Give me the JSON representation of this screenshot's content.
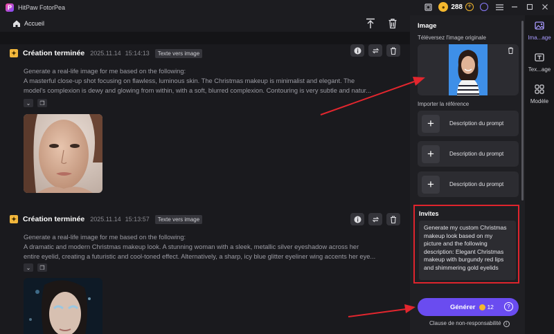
{
  "app": {
    "title": "HitPaw FotorPea",
    "credits": "288"
  },
  "nav": {
    "home_label": "Accueil"
  },
  "cards": [
    {
      "status": "Création terminée",
      "date": "2025.11.14",
      "time": "15:14:13",
      "tag": "Texte vers image",
      "prompt_line1": "Generate a real-life image for me based on the following:",
      "prompt_line2": "A masterful close-up shot focusing on flawless, luminous skin. The Christmas makeup is minimalist and elegant. The",
      "prompt_line3": "model's complexion is dewy and glowing from within, with a soft, blurred complexion. Contouring is very subtle and natur..."
    },
    {
      "status": "Création terminée",
      "date": "2025.11.14",
      "time": "15:13:57",
      "tag": "Texte vers image",
      "prompt_line1": "Generate a real-life image for me based on the following:",
      "prompt_line2": "A dramatic and modern Christmas makeup look. A stunning woman with a sleek, metallic silver eyeshadow across her",
      "prompt_line3": "entire eyelid, creating a futuristic and cool-toned effect. Alternatively, a sharp, icy blue glitter eyeliner wing accents her eye..."
    }
  ],
  "panel": {
    "title": "Image",
    "upload_label": "Téléversez l'image originale",
    "reference_label": "Importer la référence",
    "reference_items": [
      "Description du prompt",
      "Description du prompt",
      "Description du prompt"
    ],
    "invites_title": "Invites",
    "invites_text": "Generate my custom Christmas makeup look based on my picture and the following description: Elegant Christmas makeup with burgundy red lips and shimmering gold eyelids",
    "generate_label": "Générer",
    "generate_cost": "12",
    "disclaimer": "Clause de non-responsabilité"
  },
  "sidebar": {
    "items": [
      {
        "label": "Ima...age",
        "icon": "image-icon",
        "active": true
      },
      {
        "label": "Tex...age",
        "icon": "text-image-icon",
        "active": false
      },
      {
        "label": "Modèle",
        "icon": "model-icon",
        "active": false
      }
    ]
  },
  "colors": {
    "accent": "#6a4cf0",
    "highlight": "#e0242d",
    "coin": "#f5b82e"
  }
}
